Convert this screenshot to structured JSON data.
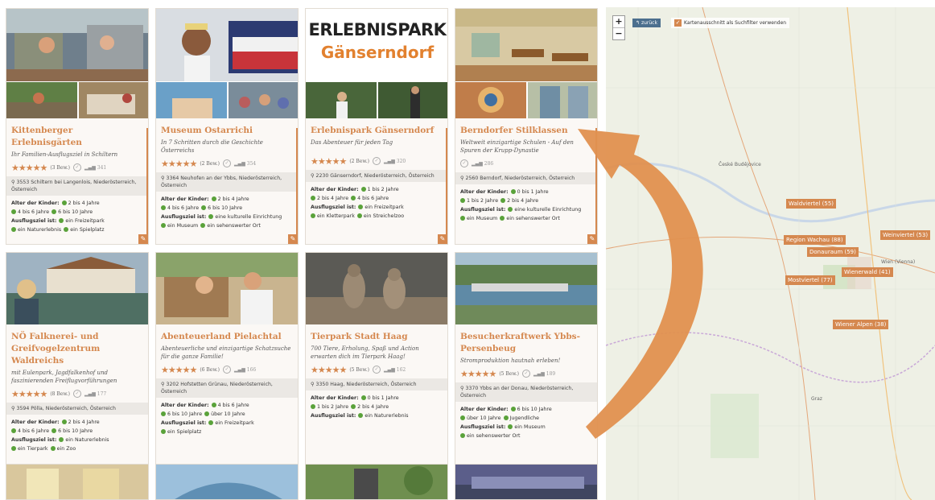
{
  "cards": [
    {
      "title": "Kittenberger Erlebnisgärten",
      "subtitle": "Ihr Familien-Ausflugsziel in Schiltern",
      "reviews": "(3 Bew.)",
      "views": "341",
      "address": "3553 Schiltern bei Langenlois, Niederösterreich, Österreich",
      "kids_label": "Alter der Kinder:",
      "kids": [
        "2 bis 4 Jahre",
        "4 bis 6 Jahre",
        "6 bis 10 Jahre"
      ],
      "ziel_label": "Ausflugsziel ist:",
      "ziel": [
        "ein Freizeitpark",
        "ein Naturerlebnis",
        "ein Spielplatz"
      ]
    },
    {
      "title": "Museum Ostarrichi",
      "subtitle": "In 7 Schritten durch die Geschichte Österreichs",
      "reviews": "(2 Bew.)",
      "views": "354",
      "address": "3364 Neuhofen an der Ybbs, Niederösterreich, Österreich",
      "kids_label": "Alter der Kinder:",
      "kids": [
        "2 bis 4 Jahre",
        "4 bis 6 Jahre",
        "6 bis 10 Jahre"
      ],
      "ziel_label": "Ausflugsziel ist:",
      "ziel": [
        "eine kulturelle Einrichtung",
        "ein Museum",
        "ein sehenswerter Ort"
      ]
    },
    {
      "title": "Erlebnispark Gänserndorf",
      "subtitle": "Das Abenteuer für jeden Tag",
      "reviews": "(2 Bew.)",
      "views": "320",
      "address": "2230 Gänserndorf, Niederösterreich, Österreich",
      "kids_label": "Alter der Kinder:",
      "kids": [
        "1 bis 2 Jahre",
        "2 bis 4 Jahre",
        "4 bis 6 Jahre"
      ],
      "ziel_label": "Ausflugsziel ist:",
      "ziel": [
        "ein Freizeitpark",
        "ein Kletterpark",
        "ein Streichelzoo"
      ],
      "logo_line1": "ERLEBNISPARK",
      "logo_line2": "Gänserndorf"
    },
    {
      "title": "Berndorfer Stilklassen",
      "subtitle": "Weltweit einzigartige Schulen - Auf den Spuren der Krupp-Dynastie",
      "views": "286",
      "address": "2560 Berndorf, Niederösterreich, Österreich",
      "kids_label": "Alter der Kinder:",
      "kids": [
        "0 bis 1 Jahre",
        "1 bis 2 Jahre",
        "2 bis 4 Jahre"
      ],
      "ziel_label": "Ausflugsziel ist:",
      "ziel": [
        "eine kulturelle Einrichtung",
        "ein Museum",
        "ein sehenswerter Ort"
      ]
    },
    {
      "title": "NÖ Falknerei- und Greifvogelzentrum Waldreichs",
      "subtitle": "mit Eulenpark, Jagdfalkenhof und faszinierenden Freiflugvorführungen",
      "reviews": "(8 Bew.)",
      "views": "177",
      "address": "3594 Pölla, Niederösterreich, Österreich",
      "kids_label": "Alter der Kinder:",
      "kids": [
        "2 bis 4 Jahre",
        "4 bis 6 Jahre",
        "6 bis 10 Jahre"
      ],
      "ziel_label": "Ausflugsziel ist:",
      "ziel": [
        "ein Naturerlebnis",
        "ein Tierpark",
        "ein Zoo"
      ]
    },
    {
      "title": "Abenteuerland Pielachtal",
      "subtitle": "Abenteuerliche und einzigartige Schatzsuche für die ganze Familie!",
      "reviews": "(6 Bew.)",
      "views": "166",
      "address": "3202 Hofstetten Grünau, Niederösterreich, Österreich",
      "kids_label": "Alter der Kinder:",
      "kids": [
        "4 bis 6 Jahre",
        "6 bis 10 Jahre",
        "über 10 Jahre"
      ],
      "ziel_label": "Ausflugsziel ist:",
      "ziel": [
        "ein Freizeitpark",
        "ein Spielplatz"
      ]
    },
    {
      "title": "Tierpark Stadt Haag",
      "subtitle": "700 Tiere, Erholung, Spaß und Action erwarten dich im Tierpark Haag!",
      "reviews": "(5 Bew.)",
      "views": "162",
      "address": "3350 Haag, Niederösterreich, Österreich",
      "kids_label": "Alter der Kinder:",
      "kids": [
        "0 bis 1 Jahre",
        "1 bis 2 Jahre",
        "2 bis 4 Jahre"
      ],
      "ziel_label": "Ausflugsziel ist:",
      "ziel": [
        "ein Naturerlebnis"
      ]
    },
    {
      "title": "Besucherkraftwerk Ybbs-Persenbeug",
      "subtitle": "Stromproduktion hautnah erleben!",
      "reviews": "(5 Bew.)",
      "views": "189",
      "address": "3370 Ybbs an der Donau, Niederösterreich, Österreich",
      "kids_label": "Alter der Kinder:",
      "kids": [
        "6 bis 10 Jahre",
        "über 10 Jahre",
        "Jugendliche"
      ],
      "ziel_label": "Ausflugsziel ist:",
      "ziel": [
        "ein Museum",
        "ein sehenswerter Ort"
      ]
    }
  ],
  "map": {
    "zoom_in": "+",
    "zoom_out": "−",
    "back_label": "zurück",
    "filter_label": "Kartenausschnitt als Suchfilter verwenden",
    "regions": [
      "Waldviertel (55)",
      "Region Wachau (88)",
      "Weinviertel (53)",
      "Donauraum (59)",
      "Wienerwald (41)",
      "Mostviertel (77)",
      "Wiener Alpen (38)"
    ],
    "places": [
      "Wien (Vienna)",
      "Graz",
      "České Budějovice"
    ]
  },
  "colors": {
    "accent": "#d5884f",
    "check": "#5aa23a",
    "back": "#4c6f8e"
  }
}
